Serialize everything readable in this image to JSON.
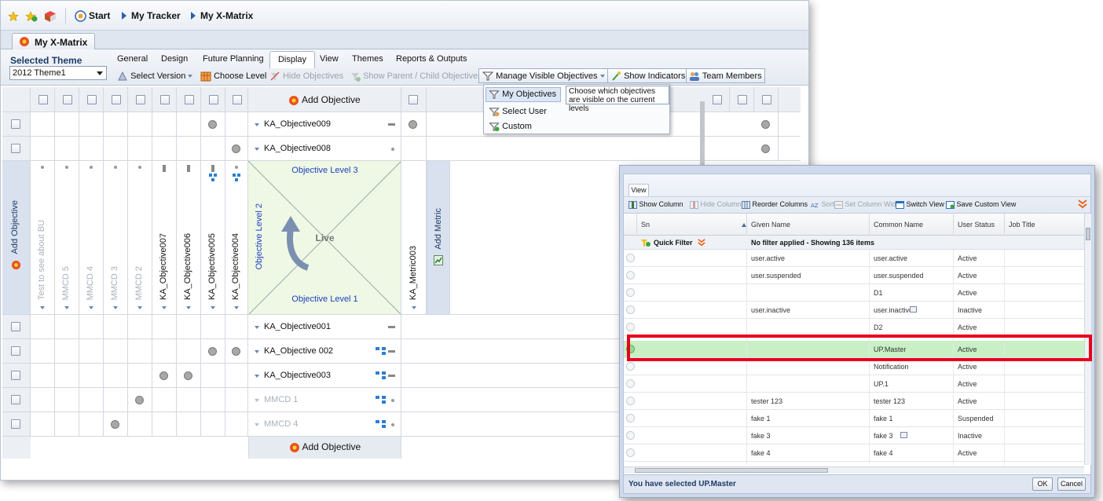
{
  "breadcrumb": {
    "start": "Start",
    "tracker": "My Tracker",
    "xmatrix": "My X-Matrix"
  },
  "window_tab": "My X-Matrix",
  "selected_theme": {
    "label": "Selected Theme",
    "value": "2012 Theme1"
  },
  "ribbon_tabs": [
    "General",
    "Design",
    "Future Planning",
    "Display",
    "View",
    "Themes",
    "Reports & Outputs"
  ],
  "active_tab": "Display",
  "toolbar": {
    "select_version": "Select Version",
    "choose_level": "Choose Level",
    "hide_objectives": "Hide Objectives",
    "show_parent_child": "Show Parent / Child Objectives",
    "manage_visible": "Manage Visible Objectives",
    "show_indicators": "Show Indicators",
    "team_members": "Team Members"
  },
  "dropdown": {
    "items": [
      "My Objectives",
      "Select User",
      "Custom"
    ],
    "tooltip": "Choose which objectives are visible on the current levels"
  },
  "matrix": {
    "add_objective": "Add Objective",
    "add_metric": "Add Metric",
    "top_rows": [
      "KA_Objective009",
      "KA_Objective008"
    ],
    "bottom_rows": [
      "KA_Objective001",
      "KA_Objective 002",
      "KA_Objective003",
      "MMCD 1",
      "MMCD 4"
    ],
    "columns": [
      "Test to see about BU",
      "MMCD 5",
      "MMCD 4",
      "MMCD 3",
      "MMCD 2",
      "KA_Objective007",
      "KA_Objective006",
      "KA_Objective005",
      "KA_Objective004"
    ],
    "metric": "KA_Metric003",
    "level3": "Objective Level 3",
    "level2": "Objective Level 2",
    "level1": "Objective Level 1",
    "live": "Live"
  },
  "dialog": {
    "tab": "View",
    "toolbar": [
      "Show Column",
      "Hide Column",
      "Reorder Columns",
      "Sort",
      "Set Column Width",
      "Switch View",
      "Save Custom View"
    ],
    "headers": [
      "Sn",
      "Given Name",
      "Common Name",
      "User Status",
      "Job Title"
    ],
    "quick_filter": "Quick Filter",
    "filter_status": "No filter applied - Showing 136 items",
    "rows": [
      [
        "user.active",
        "user.active",
        "Active"
      ],
      [
        "user.suspended",
        "user.suspended",
        "Active"
      ],
      [
        "",
        "D1",
        "Active"
      ],
      [
        "user.inactive",
        "user.inactive",
        "Inactive"
      ],
      [
        "",
        "D2",
        "Active"
      ],
      [
        "",
        "UP.Master",
        "Active"
      ],
      [
        "",
        "Notification",
        "Active"
      ],
      [
        "",
        "UP.1",
        "Active"
      ],
      [
        "tester 123",
        "tester 123",
        "Active"
      ],
      [
        "fake 1",
        "fake 1",
        "Suspended"
      ],
      [
        "fake 3",
        "fake 3",
        "Inactive"
      ],
      [
        "fake 4",
        "fake 4",
        "Active"
      ]
    ],
    "status": "You have selected UP.Master",
    "ok": "OK",
    "cancel": "Cancel"
  },
  "colors": {
    "highlight": "#e8001c",
    "selected_row": "#c8f0c4",
    "accent": "#2a50c8"
  }
}
